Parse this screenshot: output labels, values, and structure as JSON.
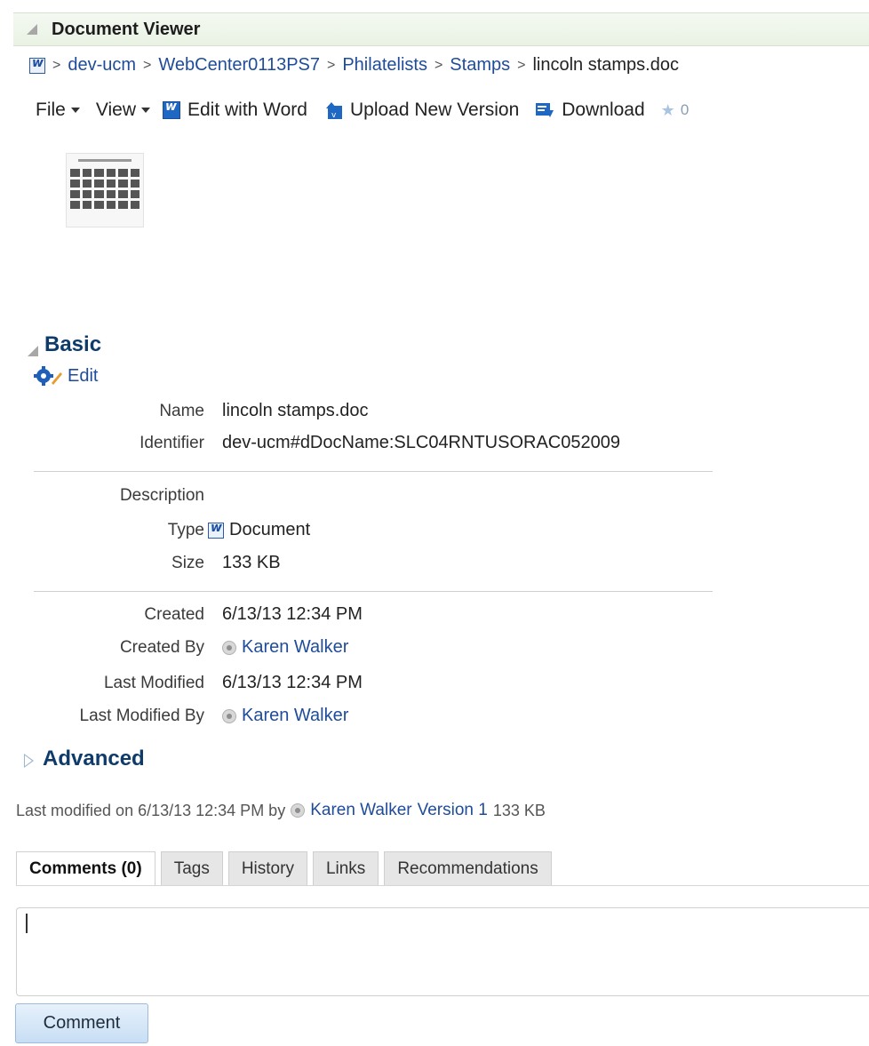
{
  "header": {
    "title": "Document Viewer"
  },
  "breadcrumb": {
    "items": [
      "dev-ucm",
      "WebCenter0113PS7",
      "Philatelists",
      "Stamps",
      "lincoln stamps.doc"
    ],
    "separator": ">"
  },
  "toolbar": {
    "file": "File",
    "view": "View",
    "edit_with_word": "Edit with Word",
    "upload": "Upload New Version",
    "download": "Download",
    "rating": "0"
  },
  "basic": {
    "title": "Basic",
    "edit": "Edit",
    "fields": {
      "name_label": "Name",
      "name_value": "lincoln stamps.doc",
      "identifier_label": "Identifier",
      "identifier_value": "dev-ucm#dDocName:SLC04RNTUSORAC052009",
      "description_label": "Description",
      "description_value": "",
      "type_label": "Type",
      "type_value": "Document",
      "size_label": "Size",
      "size_value": "133 KB",
      "created_label": "Created",
      "created_value": "6/13/13 12:34 PM",
      "created_by_label": "Created By",
      "created_by_value": "Karen Walker",
      "last_modified_label": "Last Modified",
      "last_modified_value": "6/13/13 12:34 PM",
      "last_modified_by_label": "Last Modified By",
      "last_modified_by_value": "Karen Walker"
    }
  },
  "advanced": {
    "title": "Advanced"
  },
  "last_modified_line": {
    "prefix": "Last modified on 6/13/13 12:34 PM  by",
    "user": "Karen Walker",
    "version": "Version 1",
    "size": "133 KB"
  },
  "tabs": [
    "Comments (0)",
    "Tags",
    "History",
    "Links",
    "Recommendations"
  ],
  "comment": {
    "value": "",
    "button": "Comment"
  },
  "colors": {
    "link": "#1f4c9a",
    "section_title": "#0f3b6a",
    "header_band": "#eef5ea"
  }
}
